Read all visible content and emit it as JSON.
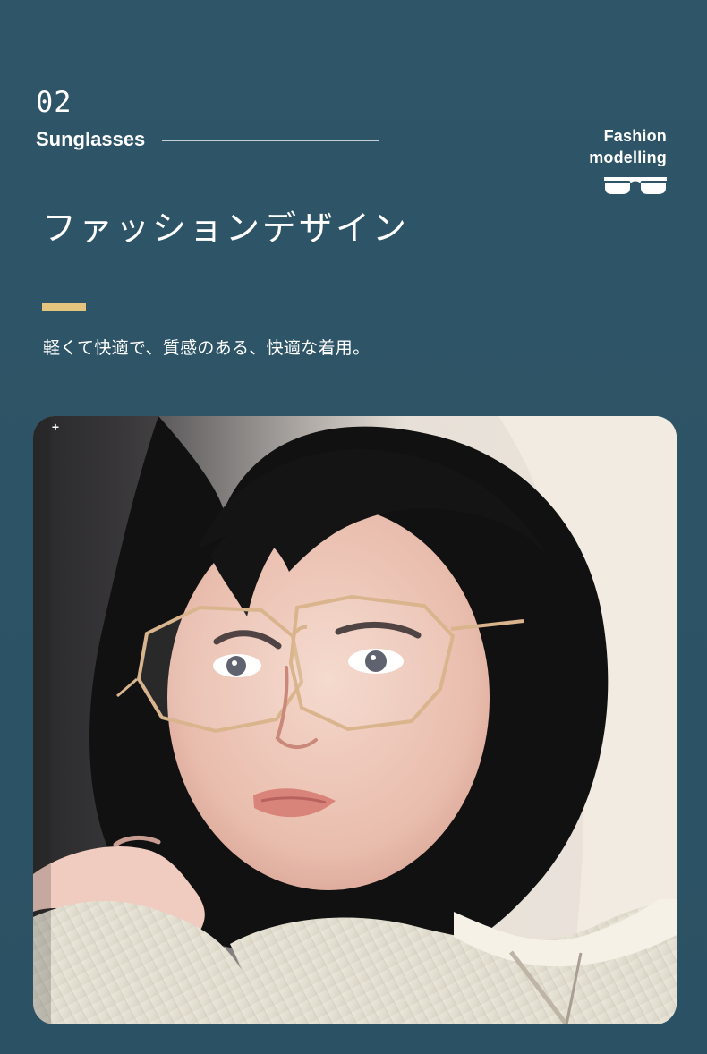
{
  "header": {
    "section_number": "02",
    "section_title": "Sunglasses",
    "fashion_line_1": "Fashion",
    "fashion_line_2": "modelling"
  },
  "hero": {
    "heading": "ファッションデザイン",
    "subtext": "軽くて快適で、質感のある、快適な着用。"
  },
  "icons": {
    "glasses": "glasses-icon",
    "plus": "plus-icon"
  },
  "colors": {
    "background": "#2c5266",
    "accent": "#e5c47d",
    "text": "#ffffff"
  }
}
